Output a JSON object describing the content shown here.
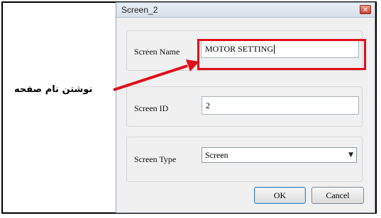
{
  "dialog": {
    "title": "Screen_2",
    "close_icon": "close-icon"
  },
  "fields": {
    "screen_name_label": "Screen Name",
    "screen_name_value": "MOTOR SETTING",
    "screen_id_label": "Screen ID",
    "screen_id_value": "2",
    "screen_type_label": "Screen Type",
    "screen_type_value": "Screen"
  },
  "buttons": {
    "ok_label": "OK",
    "cancel_label": "Cancel"
  },
  "annotation": {
    "text": "نوشتن نام صفحه",
    "highlight_color": "#e0101a"
  }
}
